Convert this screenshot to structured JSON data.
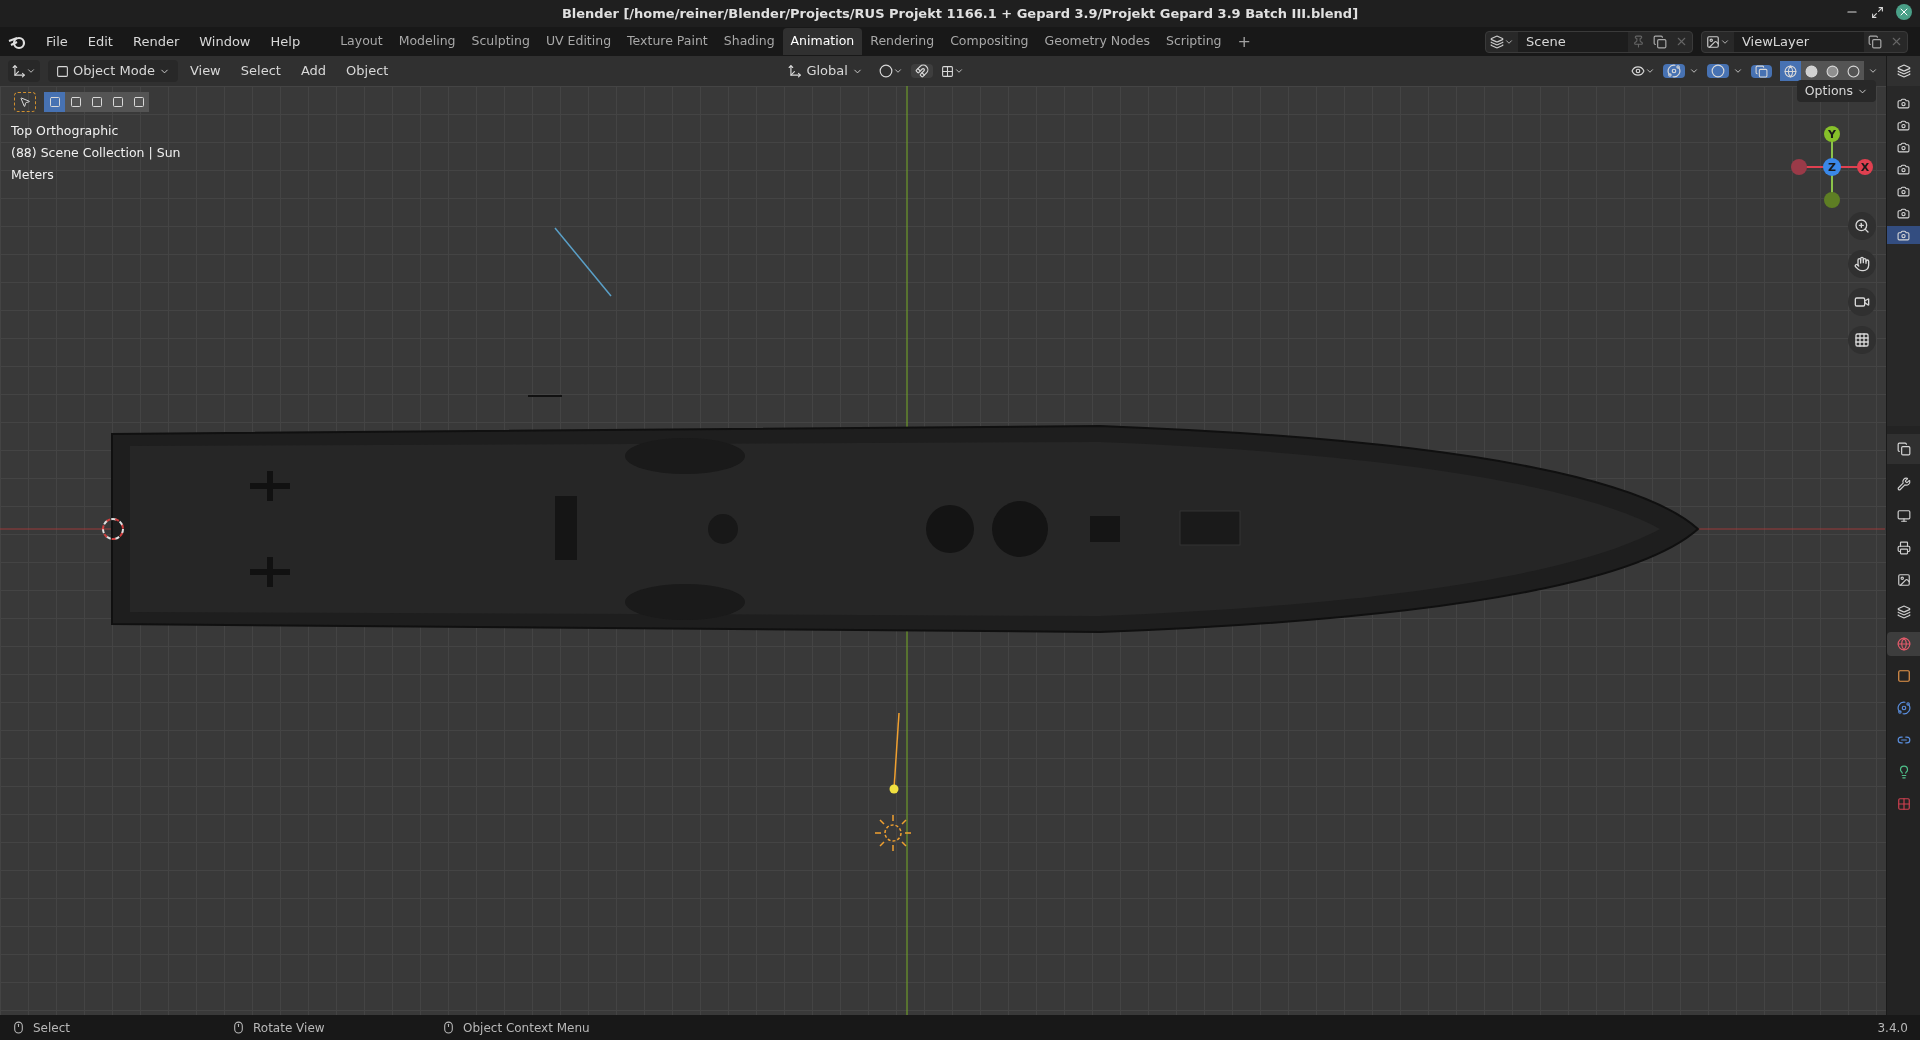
{
  "window": {
    "title": "Blender [/home/reiner/Blender/Projects/RUS Projekt 1166.1 + Gepard 3.9/Projekt Gepard 3.9 Batch III.blend]"
  },
  "menus": [
    "File",
    "Edit",
    "Render",
    "Window",
    "Help"
  ],
  "workspaces": [
    {
      "label": "Layout",
      "selected": false
    },
    {
      "label": "Modeling",
      "selected": false
    },
    {
      "label": "Sculpting",
      "selected": false
    },
    {
      "label": "UV Editing",
      "selected": false
    },
    {
      "label": "Texture Paint",
      "selected": false
    },
    {
      "label": "Shading",
      "selected": false
    },
    {
      "label": "Animation",
      "selected": true
    },
    {
      "label": "Rendering",
      "selected": false
    },
    {
      "label": "Compositing",
      "selected": false
    },
    {
      "label": "Geometry Nodes",
      "selected": false
    },
    {
      "label": "Scripting",
      "selected": false
    }
  ],
  "add_workspace": "+",
  "scene": "Scene",
  "view_layer": "ViewLayer",
  "header": {
    "mode": "Object Mode",
    "menus": [
      "View",
      "Select",
      "Add",
      "Object"
    ],
    "orientation": "Global",
    "options": "Options"
  },
  "select_modes": [
    {
      "selected": true
    },
    {
      "selected": false
    },
    {
      "selected": false
    },
    {
      "selected": false
    },
    {
      "selected": false
    }
  ],
  "shading": [
    {
      "kind": "wireframe",
      "selected": true
    },
    {
      "kind": "solid",
      "selected": false
    },
    {
      "kind": "material",
      "selected": false
    },
    {
      "kind": "rendered",
      "selected": false
    }
  ],
  "overlay_text": [
    "Top Orthographic",
    "(88) Scene Collection | Sun",
    "Meters"
  ],
  "gizmo": {
    "y": "Y",
    "z": "Z",
    "x": "X"
  },
  "outliner_rows": [
    {
      "selected": false
    },
    {
      "selected": false
    },
    {
      "selected": false
    },
    {
      "selected": false
    },
    {
      "selected": false
    },
    {
      "selected": false
    },
    {
      "selected": true
    }
  ],
  "property_tabs": [
    {
      "kind": "tool",
      "selected": false
    },
    {
      "kind": "render",
      "selected": false
    },
    {
      "kind": "output",
      "selected": false
    },
    {
      "kind": "viewlayer",
      "selected": false
    },
    {
      "kind": "scene",
      "selected": false
    },
    {
      "kind": "world",
      "selected": true
    },
    {
      "kind": "object",
      "selected": false
    },
    {
      "kind": "physics",
      "selected": false
    },
    {
      "kind": "constraints",
      "selected": false
    },
    {
      "kind": "light",
      "selected": false
    },
    {
      "kind": "texture",
      "selected": false
    }
  ],
  "status_bar": [
    {
      "label": "Select"
    },
    {
      "label": "Rotate View"
    },
    {
      "label": "Object Context Menu"
    }
  ],
  "version": "3.4.0"
}
